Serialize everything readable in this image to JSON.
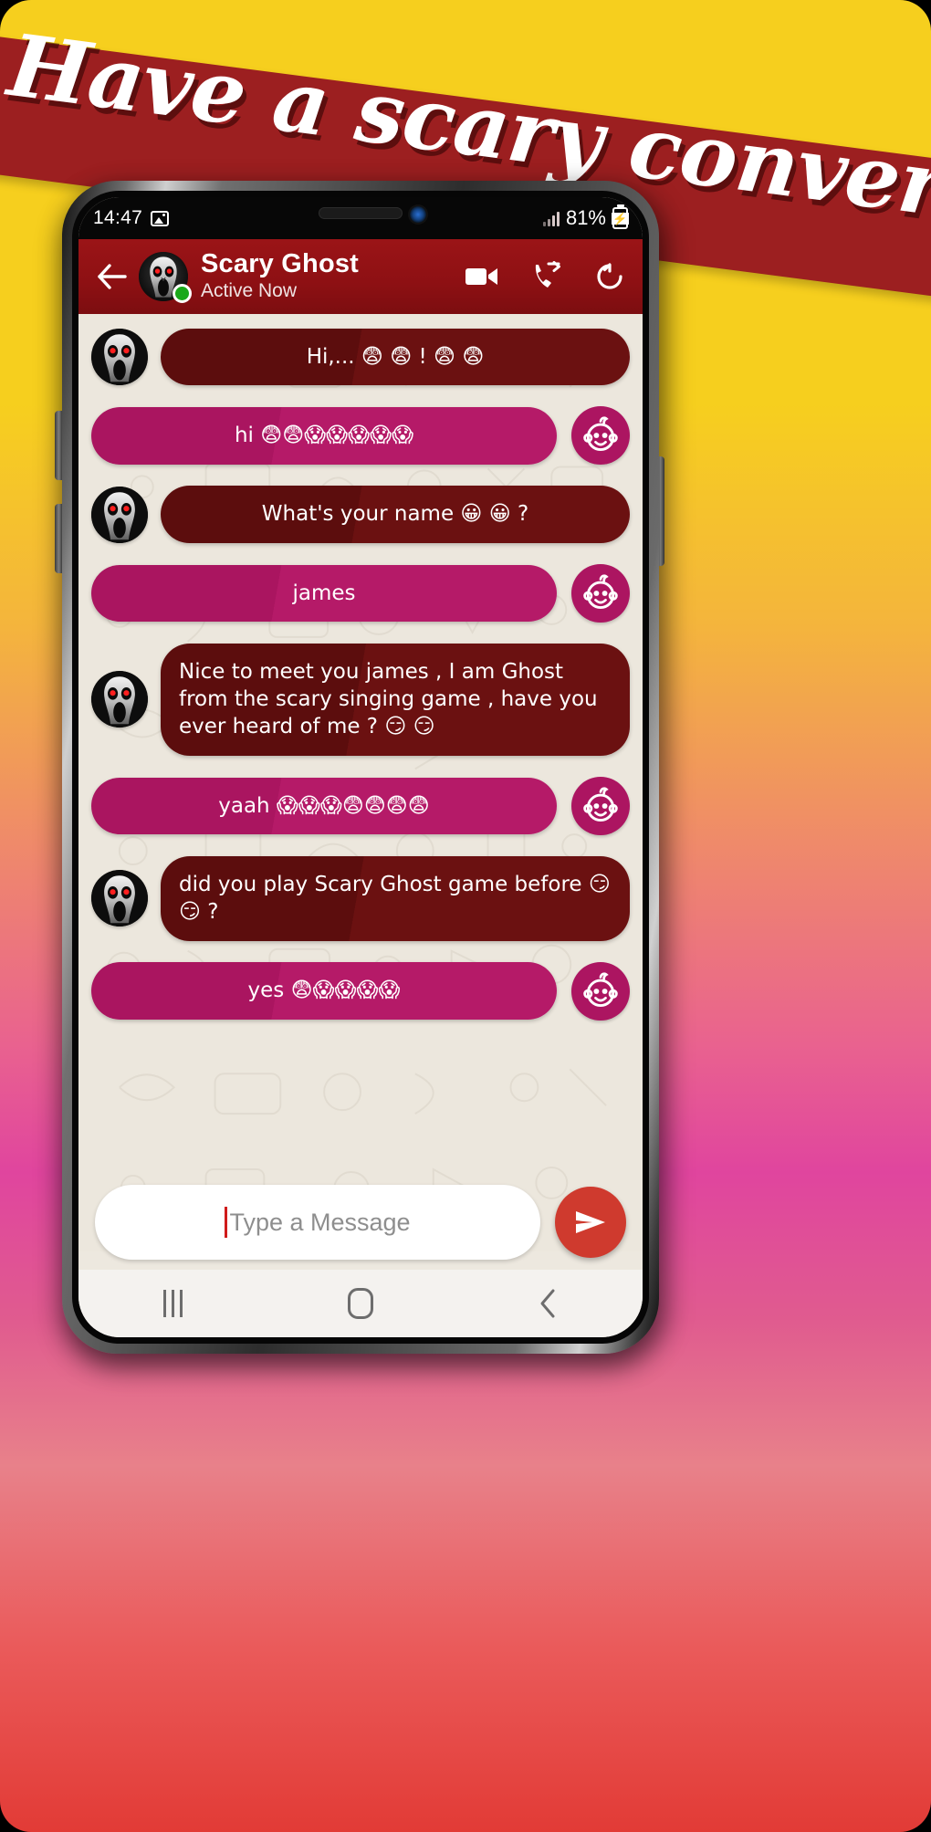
{
  "promo": {
    "headline": "Have a scary conversation"
  },
  "statusbar": {
    "clock": "14:47",
    "image_icon": "image-icon",
    "signal_icon": "signal-bars-icon",
    "battery_percent": "81%",
    "battery_icon": "battery-charging-icon"
  },
  "header": {
    "back_icon": "back-arrow-icon",
    "avatar": "ghost-avatar",
    "online_badge": "online-status-dot",
    "title": "Scary Ghost",
    "subtitle": "Active Now",
    "video_call_icon": "video-camera-icon",
    "call_forward_icon": "call-forward-icon",
    "refresh_icon": "refresh-icon",
    "brand_color": "#8d1013"
  },
  "chat": {
    "incoming_bubble_color": "#5c0d0d",
    "outgoing_bubble_color": "#ac1561",
    "background_color": "#ece7dd",
    "messages": [
      {
        "side": "in",
        "avatar": "ghost-avatar",
        "text": "Hi,... 😨 😨 ! 😨 😨",
        "align": "center"
      },
      {
        "side": "out",
        "avatar": "baby-avatar",
        "text": "hi 😨😨😱😱😱😱😱"
      },
      {
        "side": "in",
        "avatar": "ghost-avatar",
        "text": "What's your name 😀 😀 ?",
        "align": "center"
      },
      {
        "side": "out",
        "avatar": "baby-avatar",
        "text": "james"
      },
      {
        "side": "in",
        "avatar": "ghost-avatar",
        "text": "Nice to meet you james , I am Ghost from the scary singing game , have you ever heard of me  ? 😏 😏",
        "align": "left"
      },
      {
        "side": "out",
        "avatar": "baby-avatar",
        "text": "yaah 😱😱😱😨😨😨😨"
      },
      {
        "side": "in",
        "avatar": "ghost-avatar",
        "text": "did you play Scary Ghost game before 😏 😏 ?",
        "align": "left"
      },
      {
        "side": "out",
        "avatar": "baby-avatar",
        "text": "yes 😨😱😱😱😱"
      }
    ]
  },
  "composer": {
    "placeholder": "Type a Message",
    "value": "",
    "send_icon": "send-icon",
    "send_color": "#cf3a2e"
  },
  "navbar": {
    "recents_icon": "recents-icon",
    "home_icon": "home-icon",
    "back_icon": "back-icon"
  }
}
